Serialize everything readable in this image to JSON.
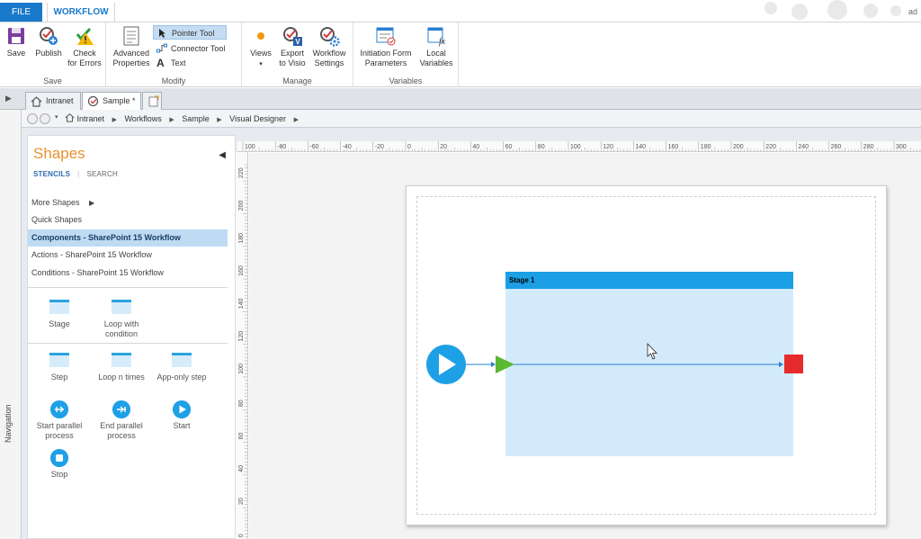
{
  "tabs": {
    "file": "FILE",
    "workflow": "WORKFLOW"
  },
  "user_stub": "ad",
  "ribbon": {
    "save_group": {
      "label": "Save",
      "save": "Save",
      "publish": "Publish",
      "check_line1": "Check",
      "check_line2": "for Errors"
    },
    "modify_group": {
      "label": "Modify",
      "advanced_line1": "Advanced",
      "advanced_line2": "Properties",
      "pointer": "Pointer Tool",
      "connector": "Connector Tool",
      "text": "Text"
    },
    "manage_group": {
      "label": "Manage",
      "views": "Views",
      "export_line1": "Export",
      "export_line2": "to Visio",
      "settings_line1": "Workflow",
      "settings_line2": "Settings"
    },
    "variables_group": {
      "label": "Variables",
      "init_line1": "Initiation Form",
      "init_line2": "Parameters",
      "local_line1": "Local",
      "local_line2": "Variables"
    }
  },
  "doc_tabs": [
    {
      "label": "Intranet"
    },
    {
      "label": "Sample *"
    }
  ],
  "breadcrumb": [
    "Intranet",
    "Workflows",
    "Sample",
    "Visual Designer"
  ],
  "navigation_label": "Navigation",
  "shapes_panel": {
    "title": "Shapes",
    "tab_stencils": "STENCILS",
    "tab_search": "SEARCH",
    "stencils": [
      "More Shapes",
      "Quick Shapes",
      "Components - SharePoint 15 Workflow",
      "Actions - SharePoint 15 Workflow",
      "Conditions - SharePoint 15 Workflow"
    ],
    "selected_stencil": "Components - SharePoint 15 Workflow",
    "items": {
      "stage": "Stage",
      "loop_cond_line1": "Loop with",
      "loop_cond_line2": "condition",
      "step": "Step",
      "loop_n": "Loop n times",
      "app_step": "App-only step",
      "start_par_line1": "Start parallel",
      "start_par_line2": "process",
      "end_par_line1": "End parallel",
      "end_par_line2": "process",
      "start": "Start",
      "stop": "Stop"
    }
  },
  "ruler_top_labels": [
    "100",
    "-80",
    "-60",
    "-40",
    "-20",
    "0",
    "20",
    "40",
    "60",
    "80",
    "100",
    "120",
    "140",
    "160",
    "180",
    "200",
    "220",
    "240",
    "260",
    "280",
    "300"
  ],
  "ruler_left_labels": [
    "220",
    "200",
    "180",
    "160",
    "140",
    "120",
    "100",
    "80",
    "60",
    "40",
    "20",
    "0"
  ],
  "stage": {
    "label": "Stage   1"
  },
  "colors": {
    "accent": "#1979ca",
    "stage_header": "#1c9fe5",
    "stage_body": "#d3eafb",
    "start_circle": "#1ea0e6",
    "start_triangle": "#5bb832",
    "end_square": "#e52b2b"
  }
}
